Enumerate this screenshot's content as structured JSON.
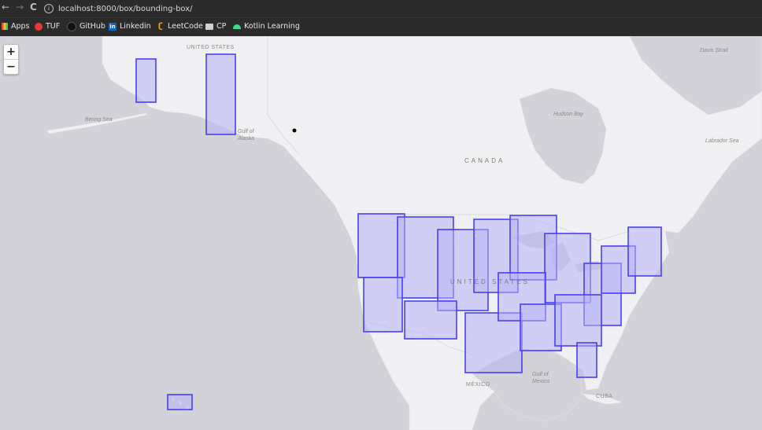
{
  "browser": {
    "url": "localhost:8000/box/bounding-box/",
    "bookmarks": [
      {
        "label": "Apps",
        "icon": "apps-grid-icon"
      },
      {
        "label": "TUF",
        "icon": "tuf-logo-icon"
      },
      {
        "label": "GitHub",
        "icon": "github-icon"
      },
      {
        "label": "Linkedin",
        "icon": "linkedin-icon"
      },
      {
        "label": "LeetCode",
        "icon": "leetcode-icon"
      },
      {
        "label": "CP",
        "icon": "folder-icon"
      },
      {
        "label": "Kotlin Learning",
        "icon": "android-icon"
      }
    ]
  },
  "map": {
    "zoom_in": "+",
    "zoom_out": "−",
    "labels": {
      "us_top": "UNITED STATES",
      "canada": "CANADA",
      "us_main": "UNITED STATES",
      "mexico": "MÉXICO",
      "cuba": "CUBA",
      "bering": "Bering Sea",
      "alaska_gulf": "Gulf of Alaska",
      "hudson": "Hudson Bay",
      "labrador": "Labrador Sea",
      "davis": "Davis Strait",
      "gulf_mexico": "Gulf of Mexico"
    },
    "box_fill": "#b7b3f5",
    "box_stroke": "#4a3ff0",
    "land_color": "#f0eff1",
    "water_color": "#d3d2d8"
  }
}
